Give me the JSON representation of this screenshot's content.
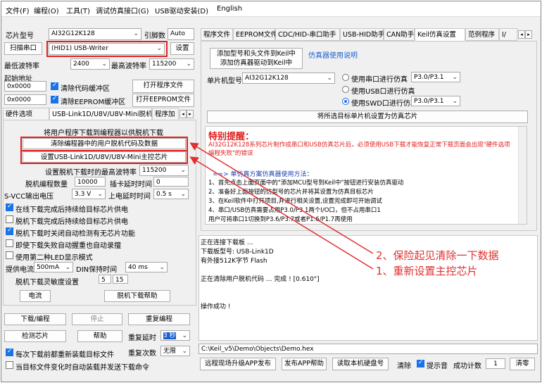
{
  "menu": [
    "文件(F)",
    "编程(O)",
    "工具(T)",
    "调试仿真接口(G)",
    "USB驱动安装(D)",
    "English"
  ],
  "left": {
    "chip_label": "芯片型号",
    "chip_value": "AI32G12K128",
    "chip_pin_label": "引脚数",
    "chip_pin_value": "Auto",
    "scan_label": "扫描串口",
    "port_value": "(HID1) USB-Writer",
    "settings_btn": "设置",
    "min_baud_label": "最低波特率",
    "min_baud_value": "2400",
    "max_baud_label": "最高波特率",
    "max_baud_value": "115200",
    "start_addr_label": "起始地址",
    "addr1": "0x0000",
    "clear_code": "清除代码缓冲区",
    "open_prog": "打开程序文件",
    "addr2": "0x0000",
    "clear_eeprom": "清除EEPROM缓冲区",
    "open_eeprom": "打开EEPROM文件",
    "tabs": [
      "硬件选项",
      "USB-Link1D/U8V/U8V-Mini脱机",
      "程序加"
    ],
    "offline_note": "将用户程序下载到编程器以供脱机下载",
    "btn_clear_offline": "清除编程器中的用户脱机代码及数据",
    "btn_set_master": "设置USB-Link1D/U8V/U8V-Mini主控芯片",
    "max_baud_offline_label": "设置脱机下载时的最高波特率",
    "max_baud_offline_value": "115200",
    "offline_count_label": "脱机编程数量",
    "offline_count_value": "10000",
    "pull_delay_label": "插卡延时时间",
    "pull_delay_value": "0",
    "svcc_label": "S-VCC输出电压",
    "svcc_value": "3.3 V",
    "power_delay_label": "上电延时时间",
    "power_delay_value": "0.5 s",
    "options": [
      {
        "label": "在线下载完成后持续给目标芯片供电",
        "checked": true
      },
      {
        "label": "脱机下载完成后持续给目标芯片供电",
        "checked": false
      },
      {
        "label": "脱机下载时关闭自动检测有无芯片功能",
        "checked": true
      },
      {
        "label": "即使下载失败自动握重也自动录擅",
        "checked": false
      },
      {
        "label": "使用第二种LED显示模式",
        "checked": false
      }
    ],
    "supply_current_label": "提供电流",
    "supply_current_value": "500mA",
    "din_label": "DIN保持时间",
    "din_value": "40 ms",
    "sensitivity_label": "脱机下载灵敏度设置",
    "sens_a": "5",
    "sens_b": "15",
    "btn_power": "电流",
    "btn_offline_help": "脱机下载帮助",
    "btn_download": "下载/编程",
    "btn_stop": "停止",
    "btn_reprogram": "重复编程",
    "btn_check": "检测芯片",
    "btn_help": "帮助",
    "repeat_delay_label": "重复延时",
    "repeat_delay_value": "3 秒",
    "repeat_count_label": "重复次数",
    "repeat_count_value": "无限",
    "chk_reload": "每次下载前都重新装载目标文件",
    "chk_auto_send": "当目标文件变化时自动装载并发送下载命令"
  },
  "right": {
    "tabs": [
      "程序文件",
      "EEPROM文件",
      "CDC/HID-串口助手",
      "USB-HID助手",
      "CAN助手",
      "Keil仿真设置",
      "范例程序",
      "I/"
    ],
    "add_btn_line1": "添加型号和头文件到Keil中",
    "add_btn_line2": "添加仿真器驱动到Keil中",
    "emulator_help": "仿真器使用说明",
    "mcu_label": "单片机型号",
    "mcu_value": "AI32G12K128",
    "radio_serial": "使用串口进行仿真",
    "radio_serial_port": "P3.0/P3.1",
    "radio_usb": "使用USB口进行仿真",
    "radio_swd": "使用SWD口进行仿真",
    "radio_swd_port": "P3.0/P3.1",
    "set_emulator_btn": "将所选目标单片机设置为仿真芯片",
    "notice_title": "特别提醒：",
    "notice_red": "AI32G12K128系列芯片制作成串口和USB仿真芯片后，必须使用USB下载才能恢复正常下载页面会出现\"硬件选项编程失败\"的错误",
    "method_title": "==> 单仿真方案仿真器使用方法：",
    "method_lines": [
      "1、首先点击上面页面中的\"添加MCU型号到Keil中\"按钮进行安装仿真驱动",
      "2、准备好上面按钮的仿型号的芯片并将其设置为仿真目标芯片",
      "3、在Keil软件中打开项目,并进行相关设置,设置完成即可开始调试",
      "4、串口/USB仿真需要占用P3.0/P3.1两个I/O口，但不占用串口1",
      "   用户可将串口1切换到P3.6/P3.7或者P1.6/P1.7再使用"
    ],
    "log_lines": [
      "正在连接下载板 ...",
      "  下载板型号: USB-Link1D",
      "  有外接512K字节 Flash",
      "",
      "正在清除用户脱机代码 ... 完成 !        [0.610\"]",
      "",
      "",
      "操作成功 !"
    ],
    "path": "C:\\Keil_v5\\Demo\\Objects\\Demo.hex",
    "btn_publish": "远程现场升级APP发布",
    "btn_app_help": "发布APP帮助",
    "btn_read_id": "读取本机硬盘号",
    "clear_label": "清除",
    "sound_label": "提示音",
    "success_count_label": "成功计数",
    "success_count_value": "1",
    "btn_clear2": "清零"
  },
  "annotations": {
    "line1": "2、保险起见清除一下数据",
    "line2": "1、重新设置主控芯片",
    "color": "#e03030"
  }
}
